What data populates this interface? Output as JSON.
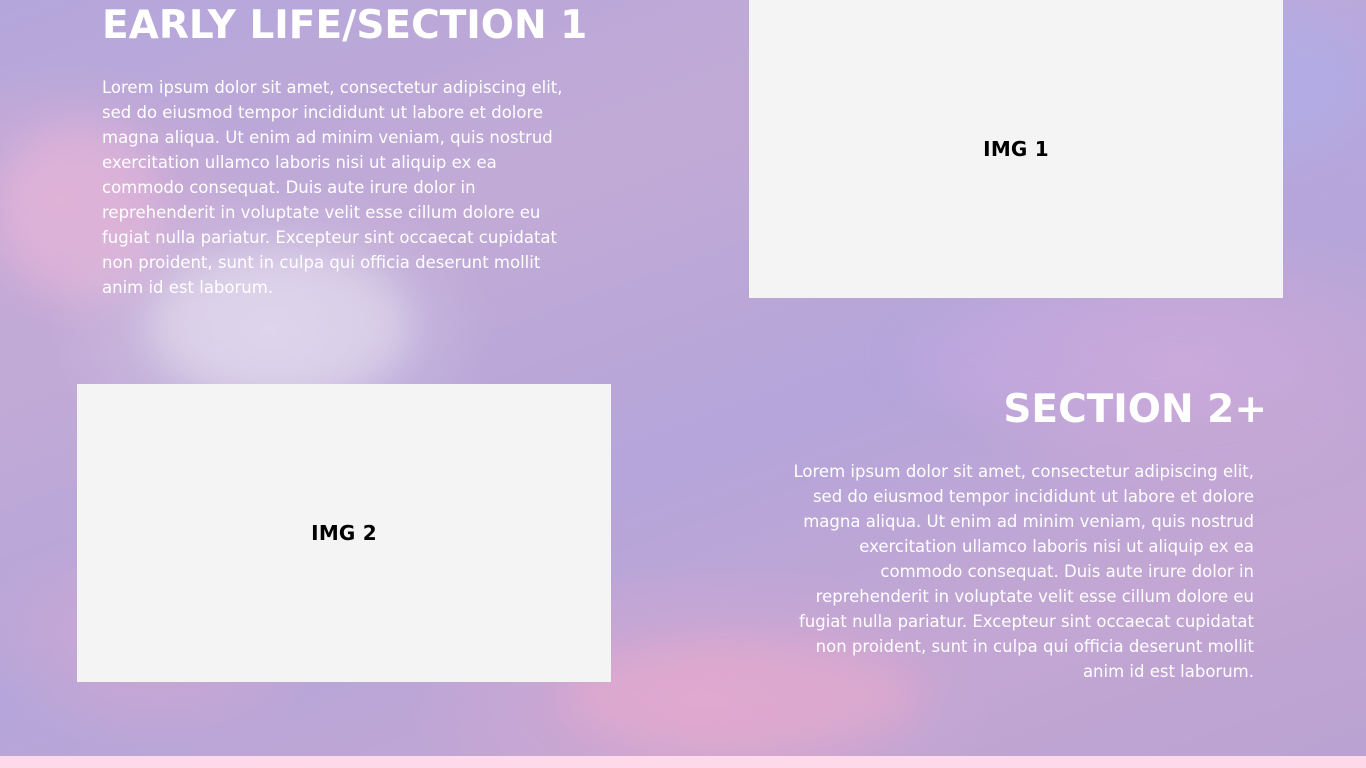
{
  "section1": {
    "heading": "EARLY LIFE/SECTION 1",
    "body": "Lorem ipsum dolor sit amet, consectetur adipiscing elit,\nsed do eiusmod tempor incididunt ut labore et dolore\nmagna aliqua. Ut enim ad minim veniam, quis nostrud\nexercitation ullamco laboris nisi ut aliquip ex ea\ncommodo consequat. Duis aute irure dolor in\nreprehenderit in voluptate velit esse cillum dolore eu\nfugiat nulla pariatur. Excepteur sint occaecat cupidatat\nnon proident, sunt in culpa qui officia deserunt mollit\nanim id est laborum.",
    "image_label": "IMG 1"
  },
  "section2": {
    "heading": "SECTION 2+",
    "body": "Lorem ipsum dolor sit amet, consectetur adipiscing elit,\nsed do eiusmod tempor incididunt ut labore et dolore\nmagna aliqua. Ut enim ad minim veniam, quis nostrud\nexercitation ullamco laboris nisi ut aliquip ex ea\ncommodo consequat. Duis aute irure dolor in\nreprehenderit in voluptate velit esse cillum dolore eu\nfugiat nulla pariatur. Excepteur sint occaecat cupidatat\nnon proident, sunt in culpa qui officia deserunt mollit\nanim id est laborum.",
    "image_label": "IMG 2"
  },
  "colors": {
    "text": "#ffffff",
    "placeholder_bg": "#f4f4f4",
    "placeholder_text": "#000000",
    "sky_lavender": "#b4a6db",
    "sky_pink": "#e8aacd",
    "footer_strip": "#fdd9ea"
  }
}
